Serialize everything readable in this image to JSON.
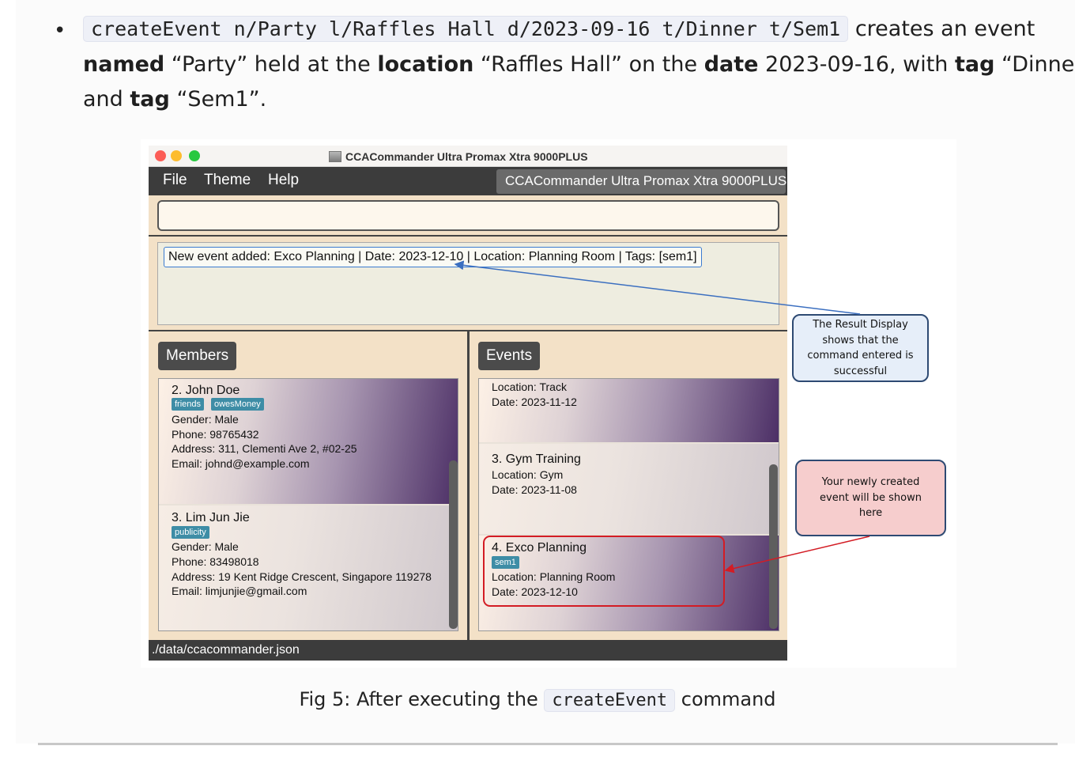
{
  "document": {
    "bullet": "•",
    "code_example": "createEvent n/Party l/Raffles Hall d/2023-09-16 t/Dinner t/Sem1",
    "line1_after": " creates an event",
    "line2": [
      {
        "t": "named",
        "b": true
      },
      {
        "t": " “Party” held at the ",
        "b": false
      },
      {
        "t": "location",
        "b": true
      },
      {
        "t": " “Raffles Hall” on the ",
        "b": false
      },
      {
        "t": "date",
        "b": true
      },
      {
        "t": " 2023-09-16, with ",
        "b": false
      },
      {
        "t": "tag",
        "b": true
      },
      {
        "t": " “Dinner”",
        "b": false
      }
    ],
    "line3": [
      {
        "t": "and ",
        "b": false
      },
      {
        "t": "tag",
        "b": true
      },
      {
        "t": " “Sem1”.",
        "b": false
      }
    ],
    "caption_before": "Fig 5: After executing the ",
    "caption_code": "createEvent",
    "caption_after": " command"
  },
  "app": {
    "window_title": "CCACommander Ultra Promax Xtra 9000PLUS",
    "menu": [
      "File",
      "Theme",
      "Help"
    ],
    "menu_title": "CCACommander Ultra Promax Xtra 9000PLUS",
    "command_value": "",
    "result_text": "New event added: Exco Planning | Date: 2023-12-10 | Location: Planning Room | Tags: [sem1]",
    "members_header": "Members",
    "events_header": "Events",
    "members": [
      {
        "name": "2.  John Doe",
        "tags": [
          "friends",
          "owesMoney"
        ],
        "gender": "Gender: Male",
        "phone": "Phone: 98765432",
        "address": "Address: 311, Clementi Ave 2, #02-25",
        "email": "Email: johnd@example.com"
      },
      {
        "name": "3.  Lim Jun Jie",
        "tags": [
          "publicity"
        ],
        "gender": "Gender: Male",
        "phone": "Phone: 83498018",
        "address": "Address: 19 Kent Ridge Crescent, Singapore 119278",
        "email": "Email: limjunjie@gmail.com"
      }
    ],
    "events": [
      {
        "location": "Location: Track",
        "date": "Date: 2023-11-12"
      },
      {
        "name": "3.  Gym Training",
        "location": "Location: Gym",
        "date": "Date: 2023-11-08"
      },
      {
        "name": "4.  Exco Planning",
        "tags": [
          "sem1"
        ],
        "location": "Location: Planning Room",
        "date": "Date: 2023-12-10"
      }
    ],
    "status": "./data/ccacommander.json"
  },
  "callouts": {
    "result": "The Result Display shows that the command entered is successful",
    "result_lines": [
      "The Result Display",
      "shows that the",
      "command entered is",
      "successful"
    ],
    "event": "Your newly created event will be shown here",
    "event_lines": [
      "Your newly created",
      "event will be shown",
      "here"
    ]
  },
  "colors": {
    "accent_blue": "#3b7bd0",
    "highlight_red": "#d31c24",
    "tag_blue": "#3e8da6"
  }
}
